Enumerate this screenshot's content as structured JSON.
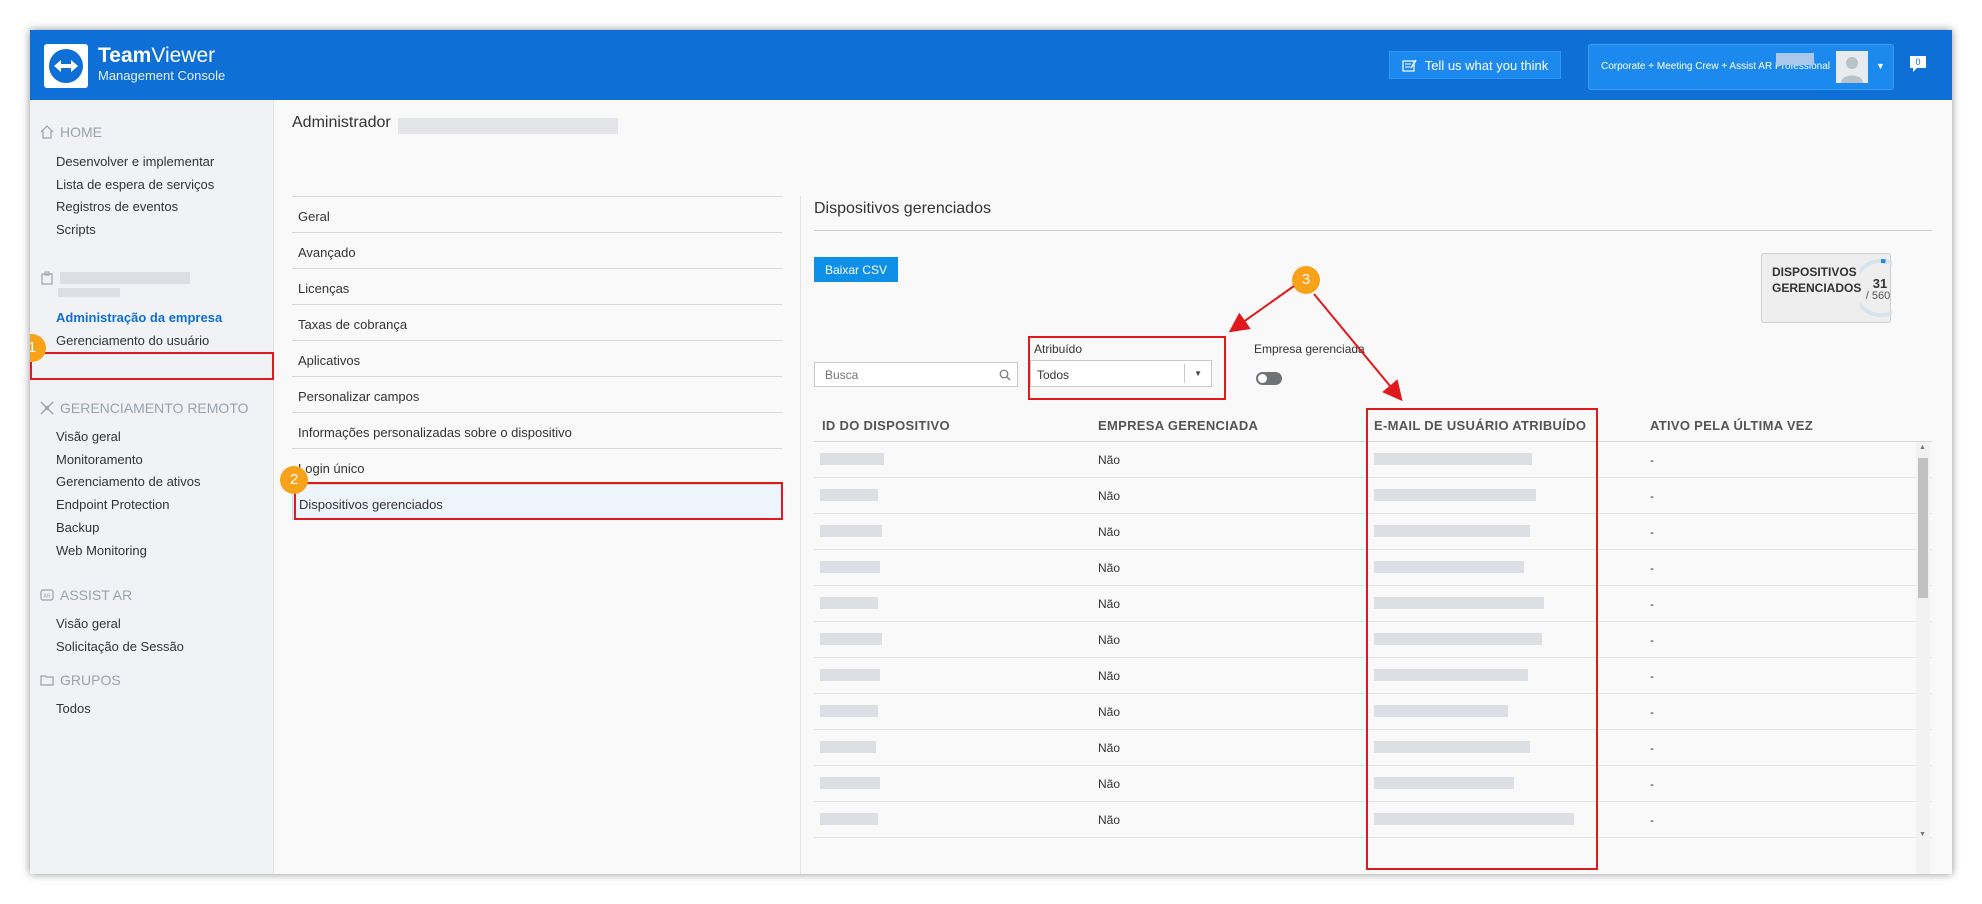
{
  "header": {
    "brand_bold": "Team",
    "brand_rest": "Viewer",
    "brand_sub": "Management Console",
    "feedback_label": "Tell us what you think",
    "account_plan": "Corporate + Meeting Crew + Assist AR Professional",
    "notification_count": "0"
  },
  "sidebar": {
    "home_label": "HOME",
    "home_items": [
      "Desenvolver e implementar",
      "Lista de espera de serviços",
      "Registros de eventos",
      "Scripts"
    ],
    "company_items": [
      "Administração da empresa",
      "Gerenciamento do usuário"
    ],
    "remote_label": "GERENCIAMENTO REMOTO",
    "remote_items": [
      "Visão geral",
      "Monitoramento",
      "Gerenciamento de ativos",
      "Endpoint Protection",
      "Backup",
      "Web Monitoring"
    ],
    "assist_label": "ASSIST AR",
    "assist_items": [
      "Visão geral",
      "Solicitação de Sessão"
    ],
    "groups_label": "GRUPOS",
    "groups_items": [
      "Todos"
    ]
  },
  "main": {
    "title": "Administrador",
    "menu": [
      "Geral",
      "Avançado",
      "Licenças",
      "Taxas de cobrança",
      "Aplicativos",
      "Personalizar campos",
      "Informações personalizadas sobre o dispositivo",
      "Login único",
      "Dispositivos gerenciados"
    ]
  },
  "panel": {
    "title": "Dispositivos gerenciados",
    "csv_button": "Baixar CSV",
    "count_label_1": "DISPOSITIVOS",
    "count_label_2": "GERENCIADOS",
    "count_value": "31",
    "count_total": "/ 560",
    "search_placeholder": "Busca",
    "assigned_label": "Atribuído",
    "assigned_value": "Todos",
    "managed_company_label": "Empresa gerenciada",
    "columns": [
      "ID DO DISPOSITIVO",
      "EMPRESA GERENCIADA",
      "E-MAIL DE USUÁRIO ATRIBUÍDO",
      "ATIVO PELA ÚLTIMA VEZ"
    ],
    "rows": [
      {
        "managed": "Não",
        "last_active": "-"
      },
      {
        "managed": "Não",
        "last_active": "-"
      },
      {
        "managed": "Não",
        "last_active": "-"
      },
      {
        "managed": "Não",
        "last_active": "-"
      },
      {
        "managed": "Não",
        "last_active": "-"
      },
      {
        "managed": "Não",
        "last_active": "-"
      },
      {
        "managed": "Não",
        "last_active": "-"
      },
      {
        "managed": "Não",
        "last_active": "-"
      },
      {
        "managed": "Não",
        "last_active": "-"
      },
      {
        "managed": "Não",
        "last_active": "-"
      },
      {
        "managed": "Não",
        "last_active": "-"
      }
    ]
  },
  "annotations": {
    "step1": "1",
    "step2": "2",
    "step3": "3",
    "color": "#e0191d",
    "dot_color": "#f7a218"
  },
  "colors": {
    "header_blue": "#0e6fd6",
    "accent_blue": "#0e8fe8"
  }
}
